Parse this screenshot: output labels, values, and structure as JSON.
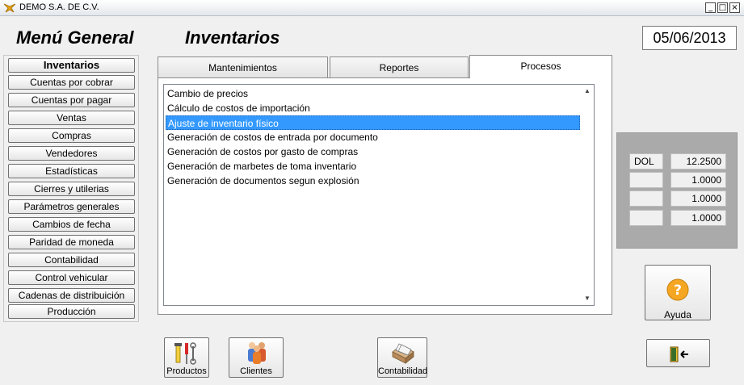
{
  "window": {
    "title": "DEMO  S.A. DE C.V.",
    "minimize_glyph": "_",
    "maximize_glyph": "□",
    "close_glyph": "×"
  },
  "header": {
    "main_title": "Menú General",
    "section_title": "Inventarios",
    "date": "05/06/2013"
  },
  "sidebar": {
    "items": [
      {
        "label": "Inventarios"
      },
      {
        "label": "Cuentas por cobrar"
      },
      {
        "label": "Cuentas por pagar"
      },
      {
        "label": "Ventas"
      },
      {
        "label": "Compras"
      },
      {
        "label": "Vendedores"
      },
      {
        "label": "Estadísticas"
      },
      {
        "label": "Cierres y utilerias"
      },
      {
        "label": "Parámetros generales"
      },
      {
        "label": "Cambios de fecha"
      },
      {
        "label": "Paridad de moneda"
      },
      {
        "label": "Contabilidad"
      },
      {
        "label": "Control vehicular"
      },
      {
        "label": "Cadenas de distribuición"
      },
      {
        "label": "Producción"
      }
    ]
  },
  "tabs": [
    {
      "label": "Mantenimientos"
    },
    {
      "label": "Reportes"
    },
    {
      "label": "Procesos"
    }
  ],
  "process_list": {
    "items": [
      "Cambio de precios",
      "Cálculo de costos de importación",
      "Ajuste de inventario físico",
      "Generación de costos de entrada por documento",
      "Generación de costos por gasto de compras",
      "Generación de marbetes de toma inventario",
      "Generación de documentos segun explosión"
    ],
    "selected_index": 2,
    "scroll_up_glyph": "▲",
    "scroll_down_glyph": "▼"
  },
  "exchange_rates": [
    {
      "code": "DOL",
      "value": "12.2500"
    },
    {
      "code": "",
      "value": "1.0000"
    },
    {
      "code": "",
      "value": "1.0000"
    },
    {
      "code": "",
      "value": "1.0000"
    }
  ],
  "buttons": {
    "help": "Ayuda",
    "products": "Productos",
    "clients": "Clientes",
    "accounting": "Contabilidad"
  },
  "icons": {
    "app": "app-logo-icon",
    "help": "question-mark-icon",
    "products": "tools-icon",
    "clients": "people-icon",
    "accounting": "file-box-icon",
    "exit": "exit-door-icon"
  },
  "colors": {
    "selection": "#3399ff",
    "panel_gray": "#aaaaaa",
    "help_orange": "#f5a623"
  }
}
